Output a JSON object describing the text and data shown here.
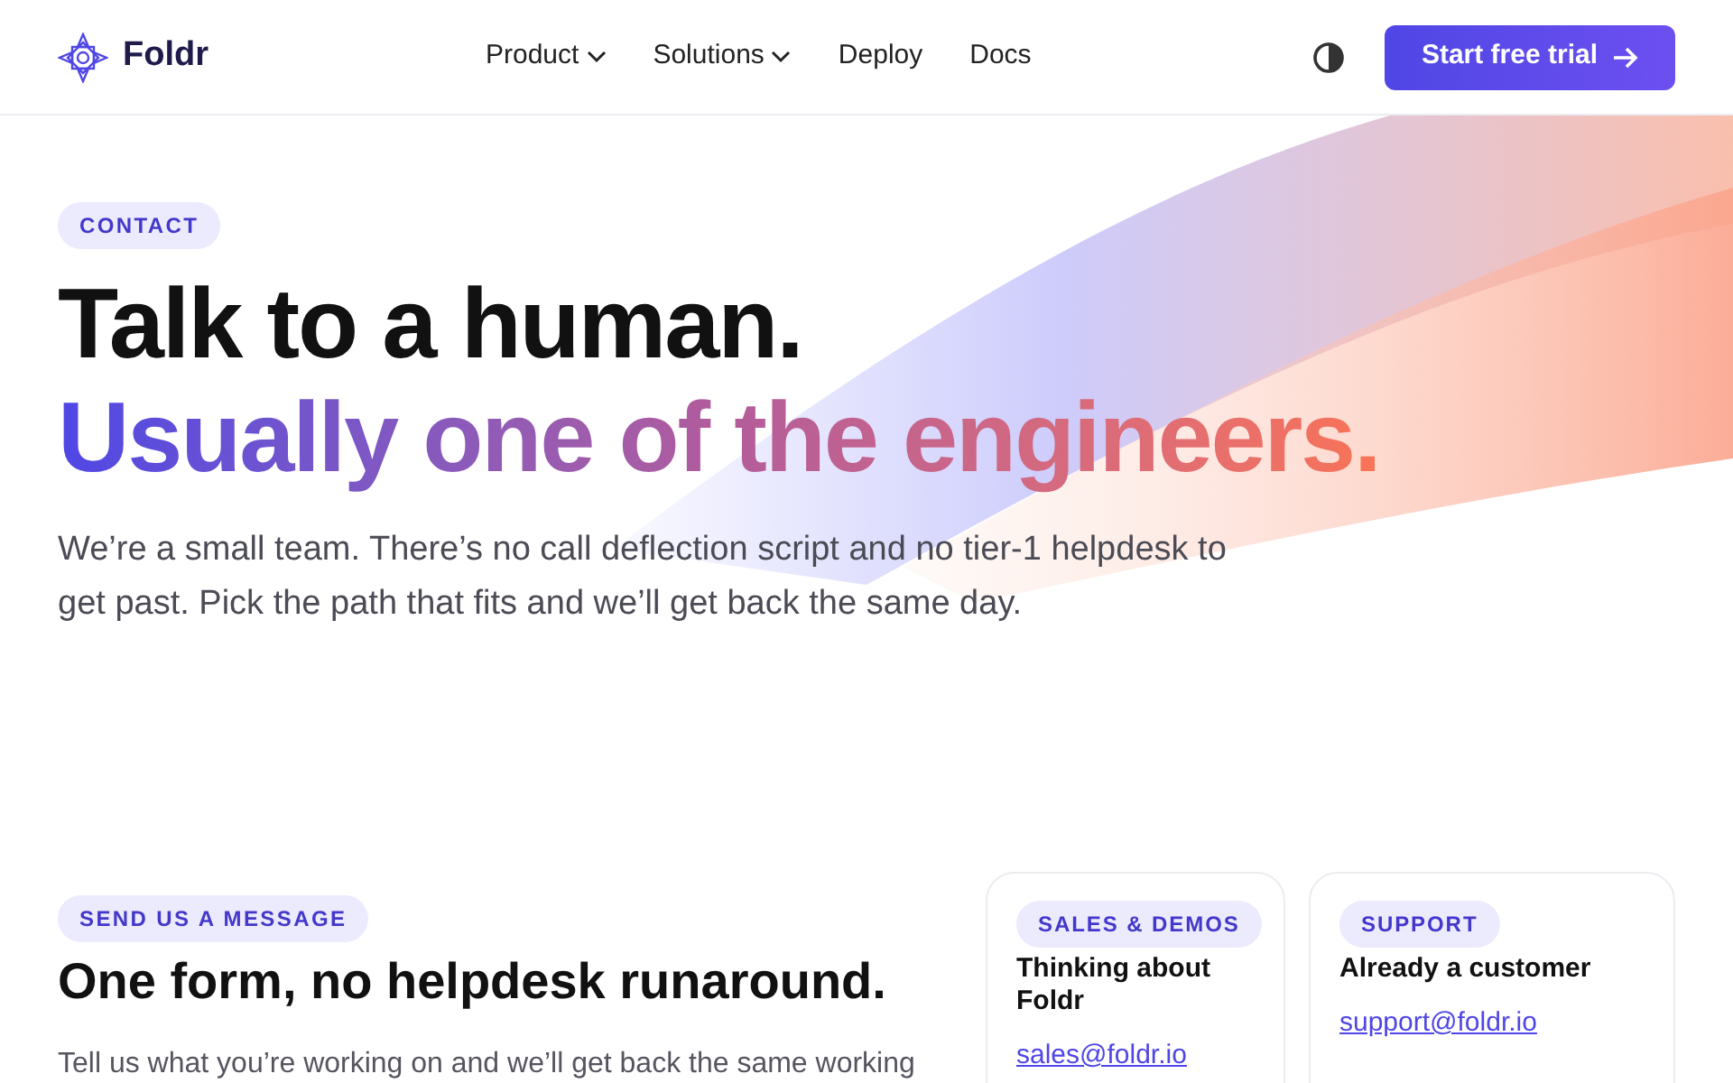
{
  "nav": {
    "brand": "Foldr",
    "links": [
      {
        "label": "Product",
        "dropdown": true
      },
      {
        "label": "Solutions",
        "dropdown": true
      },
      {
        "label": "Deploy",
        "dropdown": false
      },
      {
        "label": "Docs",
        "dropdown": false
      }
    ],
    "cta": "Start free trial"
  },
  "hero": {
    "eyebrow": "CONTACT",
    "title": "Talk to a human.",
    "subtitle": "Usually one of the engineers.",
    "text": "We’re a small team. There’s no call deflection script and no tier-1 helpdesk to get past. Pick the path that fits and we’ll get back the same day."
  },
  "message": {
    "eyebrow": "SEND US A MESSAGE",
    "title": "One form, no helpdesk runaround.",
    "text": "Tell us what you’re working on and we’ll get back the same working"
  },
  "cards": [
    {
      "eyebrow": "SALES & DEMOS",
      "title": "Thinking about Foldr",
      "email": "sales@foldr.io"
    },
    {
      "eyebrow": "SUPPORT",
      "title": "Already a customer",
      "email": "support@foldr.io"
    }
  ]
}
